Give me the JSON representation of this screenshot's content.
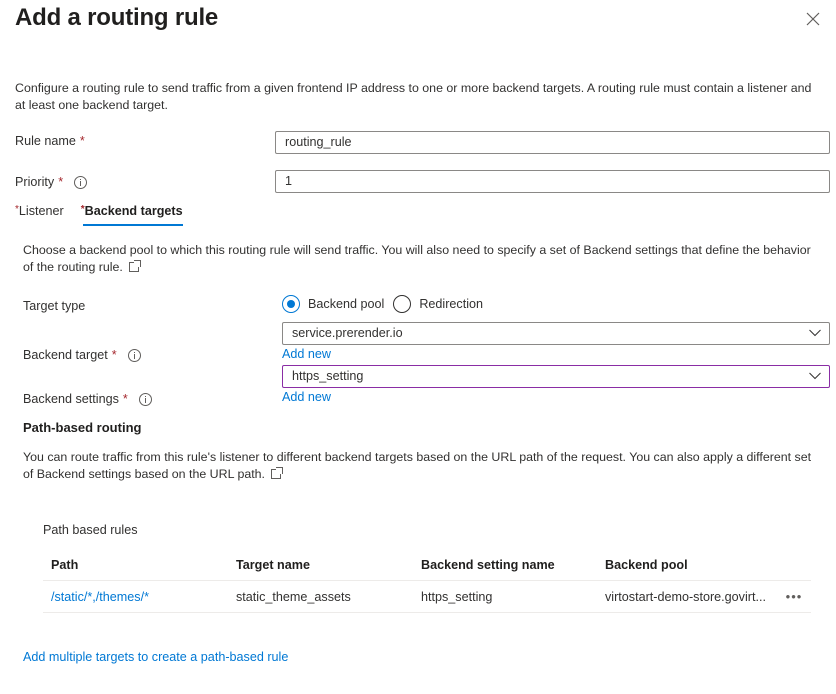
{
  "header": {
    "title": "Add a routing rule",
    "close_icon": "close-icon"
  },
  "description": "Configure a routing rule to send traffic from a given frontend IP address to one or more backend targets. A routing rule must contain a listener and at least one backend target.",
  "fields": {
    "rule_name": {
      "label": "Rule name",
      "required": "*",
      "value": "routing_rule"
    },
    "priority": {
      "label": "Priority",
      "required": "*",
      "value": "1",
      "info_icon": "info-icon"
    }
  },
  "tabs": [
    {
      "label": "Listener",
      "required": "*",
      "active": false
    },
    {
      "label": "Backend targets",
      "required": "*",
      "active": true
    }
  ],
  "backend_targets": {
    "description": "Choose a backend pool to which this routing rule will send traffic. You will also need to specify a set of Backend settings that define the behavior of the routing rule.",
    "target_type": {
      "label": "Target type",
      "options": [
        {
          "label": "Backend pool",
          "checked": true
        },
        {
          "label": "Redirection",
          "checked": false
        }
      ]
    },
    "backend_target": {
      "label": "Backend target",
      "required": "*",
      "value": "service.prerender.io",
      "add_new": "Add new"
    },
    "backend_settings": {
      "label": "Backend settings",
      "required": "*",
      "value": "https_setting",
      "add_new": "Add new"
    }
  },
  "path_routing": {
    "heading": "Path-based routing",
    "description": "You can route traffic from this rule's listener to different backend targets based on the URL path of the request. You can also apply a different set of Backend settings based on the URL path.",
    "rules_label": "Path based rules",
    "columns": [
      "Path",
      "Target name",
      "Backend setting name",
      "Backend pool"
    ],
    "rows": [
      {
        "path": "/static/*,/themes/*",
        "target_name": "static_theme_assets",
        "backend_setting": "https_setting",
        "backend_pool": "virtostart-demo-store.govirt...",
        "more": "•••"
      }
    ],
    "add_link": "Add multiple targets to create a path-based rule"
  },
  "colors": {
    "accent": "#0078d4",
    "required": "#a4262c",
    "focus_border": "#8a2da5"
  }
}
